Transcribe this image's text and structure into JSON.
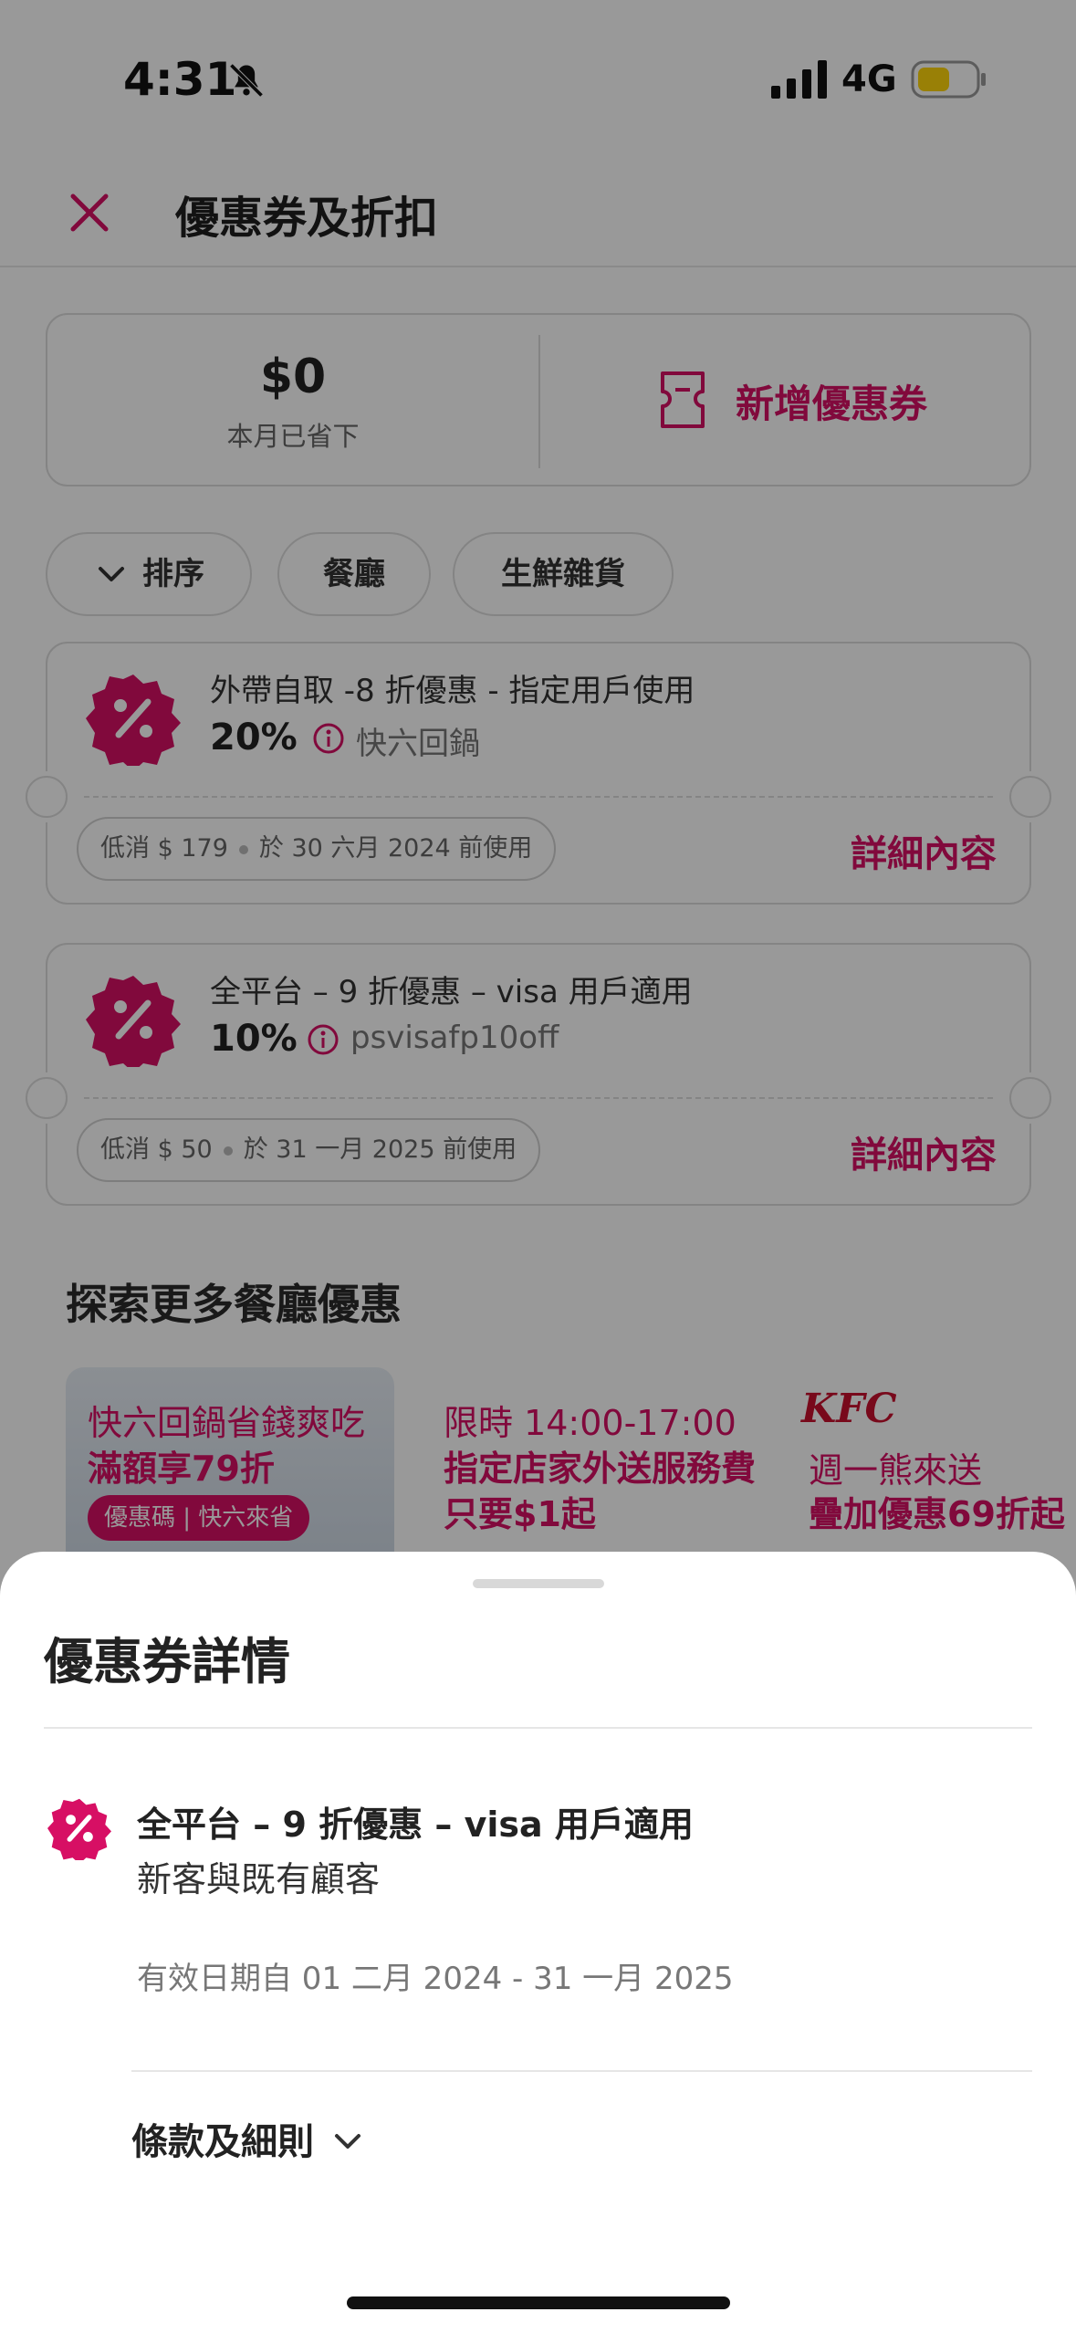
{
  "status_bar": {
    "time": "4:31",
    "network": "4G"
  },
  "header": {
    "title": "優惠券及折扣"
  },
  "savings": {
    "amount": "$0",
    "label": "本月已省下",
    "add_voucher": "新增優惠券"
  },
  "filters": {
    "sort": "排序",
    "restaurant": "餐廳",
    "grocery": "生鮮雜貨"
  },
  "vouchers": [
    {
      "title": "外帶自取 -8 折優惠 - 指定用戶使用",
      "percent": "20%",
      "code": "快六回鍋",
      "min_spend": "低消 $ 179",
      "expiry": "於 30 六月 2024 前使用",
      "details": "詳細內容"
    },
    {
      "title": "全平台 – 9 折優惠 – visa 用戶適用",
      "percent": "10%",
      "code": "psvisafp10off",
      "min_spend": "低消 $ 50",
      "expiry": "於 31 一月 2025 前使用",
      "details": "詳細內容"
    }
  ],
  "explore": {
    "title": "探索更多餐廳優惠",
    "banners": [
      {
        "line1": "快六回鍋省錢爽吃",
        "line2": "滿額享79折",
        "pill": "優惠碼 | 快六來省"
      },
      {
        "line1": "限時 14:00-17:00",
        "line2": "指定店家外送服務費",
        "line3": "只要$1起"
      },
      {
        "brand": "KFC",
        "line1": "週一熊來送",
        "line2": "疊加優惠69折起"
      }
    ]
  },
  "sheet": {
    "title": "優惠券詳情",
    "voucher_title": "全平台 – 9 折優惠 – visa 用戶適用",
    "audience": "新客與既有顧客",
    "validity": "有效日期自 01 二月 2024 - 31 一月 2025",
    "terms": "條款及細則"
  },
  "colors": {
    "brand": "#d70f64"
  }
}
